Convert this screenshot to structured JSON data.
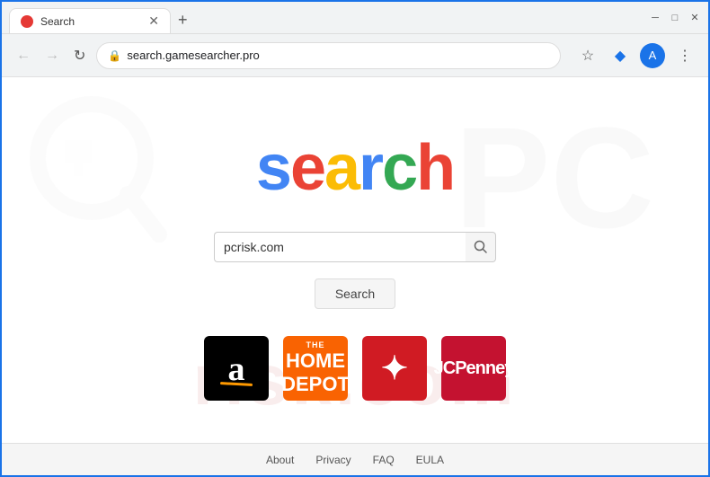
{
  "browser": {
    "tab": {
      "title": "Search",
      "favicon_color": "#e53935"
    },
    "new_tab_icon": "+",
    "window_controls": {
      "minimize": "─",
      "maximize": "□",
      "close": "✕"
    },
    "address_bar": {
      "url": "search.gamesearcher.pro",
      "lock_icon": "🔒"
    },
    "toolbar": {
      "bookmark_icon": "☆",
      "extension_icon": "◆",
      "profile_initial": "A",
      "menu_icon": "⋮"
    }
  },
  "page": {
    "logo": {
      "letters": [
        "s",
        "e",
        "a",
        "r",
        "c",
        "h"
      ],
      "colors": [
        "#4285f4",
        "#ea4335",
        "#fbbc05",
        "#4285f4",
        "#34a853",
        "#ea4335"
      ]
    },
    "search_input": {
      "value": "pcrisk.com",
      "placeholder": ""
    },
    "search_button_label": "Search",
    "shortcuts": [
      {
        "name": "Amazon",
        "label": "amazon",
        "bg": "#000000"
      },
      {
        "name": "Home Depot",
        "label": "homedepot",
        "bg": "#f96302"
      },
      {
        "name": "Macys",
        "label": "macys",
        "bg": "#d01b23"
      },
      {
        "name": "JCPenney",
        "label": "jcpenney",
        "bg": "#c41230"
      }
    ]
  },
  "footer": {
    "links": [
      "About",
      "Privacy",
      "FAQ",
      "EULA"
    ]
  }
}
